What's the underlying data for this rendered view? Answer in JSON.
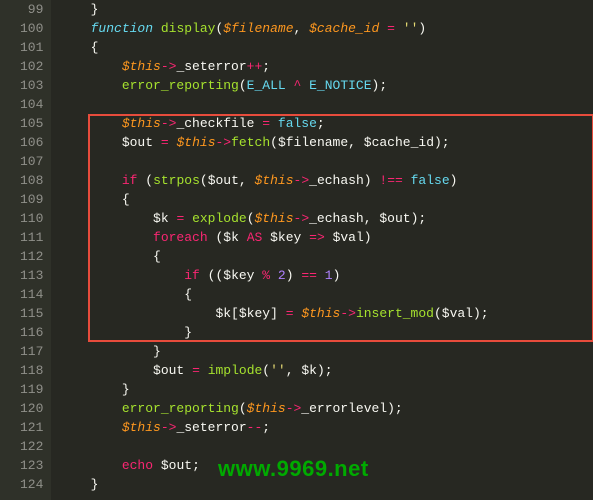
{
  "gutter": {
    "lines": [
      "99",
      "100",
      "101",
      "102",
      "103",
      "104",
      "105",
      "106",
      "107",
      "108",
      "109",
      "110",
      "111",
      "112",
      "113",
      "114",
      "115",
      "116",
      "117",
      "118",
      "119",
      "120",
      "121",
      "122",
      "123",
      "124"
    ]
  },
  "code": {
    "line99": "    }",
    "fn_keyword": "function",
    "fn_name": "display",
    "param1": "$filename",
    "param2": "$cache_id",
    "default_val": "''",
    "this_var": "$this",
    "seterror_prop": "_seterror",
    "checkfile_prop": "_checkfile",
    "echash_prop": "_echash",
    "errorlevel_prop": "_errorlevel",
    "err_report": "error_reporting",
    "eall": "E_ALL",
    "enotice": "E_NOTICE",
    "false_const": "false",
    "out_var": "$out",
    "k_var": "$k",
    "key_var": "$key",
    "val_var": "$val",
    "fetch_fn": "fetch",
    "strpos_fn": "strpos",
    "explode_fn": "explode",
    "implode_fn": "implode",
    "insert_mod_fn": "insert_mod",
    "if_kw": "if",
    "foreach_kw": "foreach",
    "echo_kw": "echo",
    "as_kw": "AS",
    "arrow": "->",
    "fat_arrow": "=>",
    "eq": "=",
    "neq": "!==",
    "eqeq": "==",
    "inc": "++",
    "dec": "--",
    "mod": "%",
    "caret": "^",
    "num1": "1",
    "num2": "2",
    "empty_str": "''"
  },
  "watermark": "www.9969.net"
}
